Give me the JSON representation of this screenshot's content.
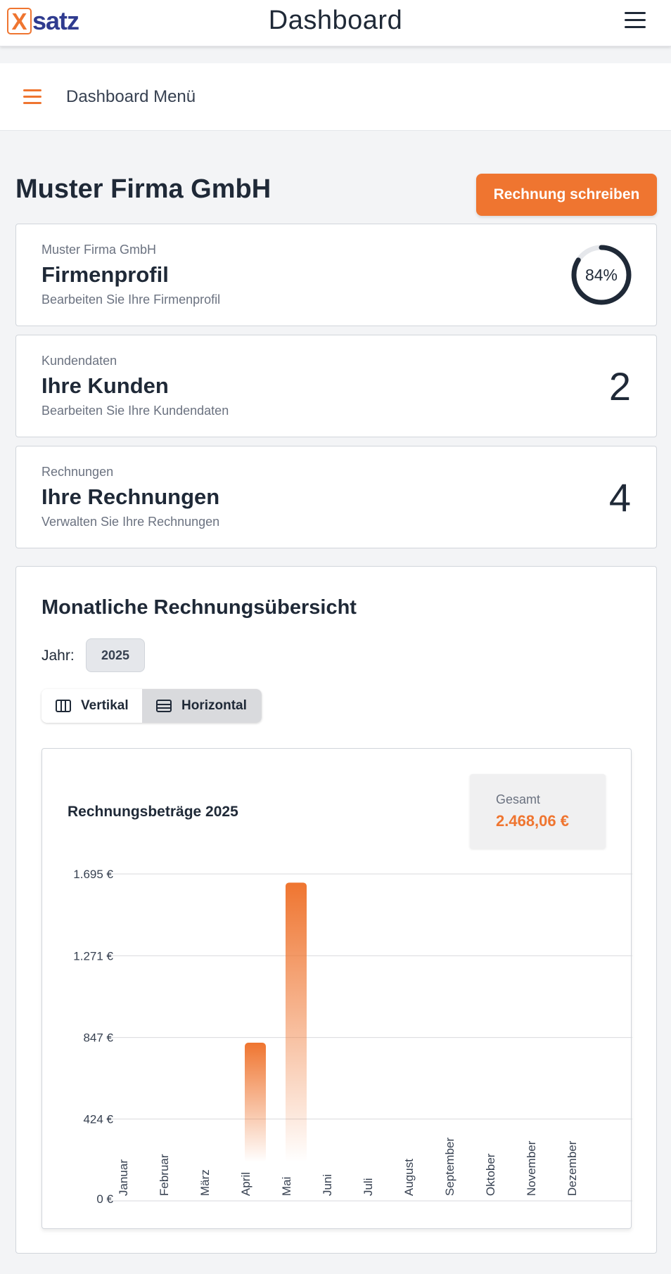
{
  "header": {
    "logo_letter": "X",
    "logo_text": "satz",
    "title": "Dashboard"
  },
  "menu": {
    "label": "Dashboard Menü"
  },
  "company": {
    "name": "Muster Firma GmbH",
    "action_label": "Rechnung schreiben"
  },
  "cards": [
    {
      "small": "Muster Firma GmbH",
      "title": "Firmenprofil",
      "desc": "Bearbeiten Sie Ihre Firmenprofil",
      "progress_percent": 84,
      "progress_label": "84%"
    },
    {
      "small": "Kundendaten",
      "title": "Ihre Kunden",
      "desc": "Bearbeiten Sie Ihre Kundendaten",
      "count": "2"
    },
    {
      "small": "Rechnungen",
      "title": "Ihre Rechnungen",
      "desc": "Verwalten Sie Ihre Rechnungen",
      "count": "4"
    }
  ],
  "overview": {
    "title": "Monatliche Rechnungsübersicht",
    "year_label": "Jahr:",
    "year_value": "2025",
    "toggle_vertical": "Vertikal",
    "toggle_horizontal": "Horizontal"
  },
  "chart_card": {
    "title": "Rechnungsbeträge 2025",
    "total_label": "Gesamt",
    "total_value": "2.468,06 €"
  },
  "colors": {
    "accent": "#ef7530",
    "text": "#1f2937",
    "muted": "#6b7280",
    "background": "#f3f4f6"
  },
  "chart_data": {
    "type": "bar",
    "title": "Rechnungsbeträge 2025",
    "categories": [
      "Januar",
      "Februar",
      "März",
      "April",
      "Mai",
      "Juni",
      "Juli",
      "August",
      "September",
      "Oktober",
      "November",
      "Dezember"
    ],
    "values": [
      0,
      0,
      0,
      820,
      1650,
      0,
      0,
      0,
      0,
      0,
      0,
      0
    ],
    "y_ticks": [
      0,
      424,
      847,
      1271,
      1695
    ],
    "y_tick_labels": [
      "0 €",
      "424 €",
      "847 €",
      "1.271 €",
      "1.695 €"
    ],
    "ylim": [
      0,
      1695
    ],
    "grid": true,
    "legend": "none",
    "bar_color": "#ef7530"
  }
}
